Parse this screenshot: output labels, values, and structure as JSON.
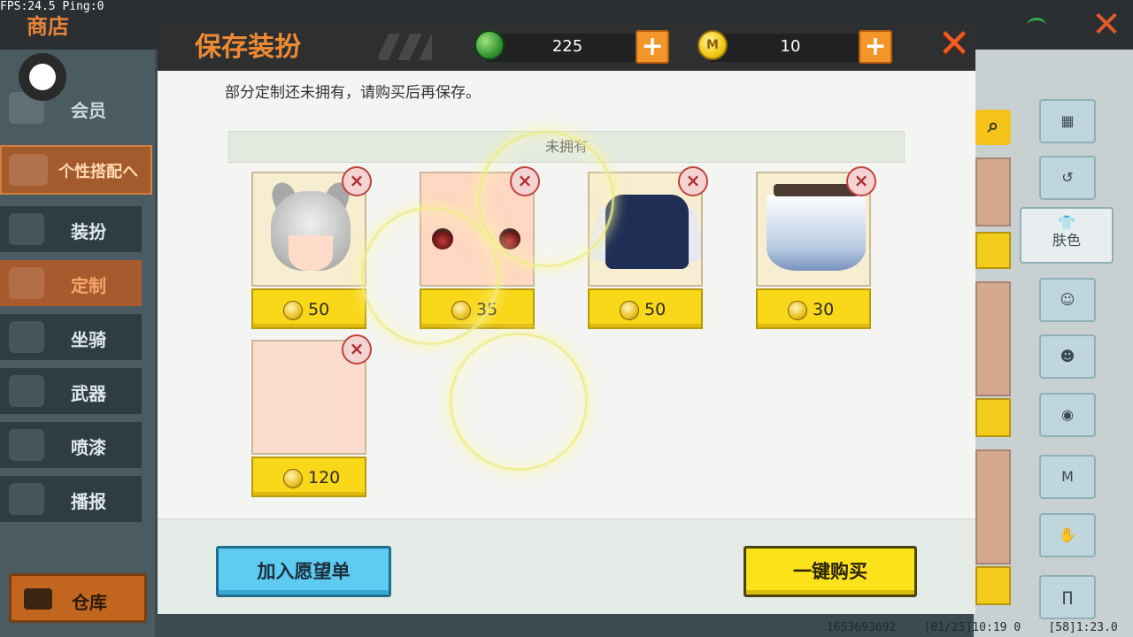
{
  "status": {
    "fps": "FPS:24.5",
    "ping": "Ping:0"
  },
  "shop": {
    "title": "商店"
  },
  "nav": {
    "vip": "会员",
    "group": "个性搭配へ",
    "items": [
      "装扮",
      "定制",
      "坐骑",
      "武器",
      "喷漆",
      "播报"
    ],
    "warehouse": "仓库"
  },
  "right_panel": {
    "skin_label": "肤色"
  },
  "modal": {
    "title": "保存装扮",
    "gems": "225",
    "coins": "10",
    "coin_symbol": "M",
    "notice": "部分定制还未拥有，请购买后再保存。",
    "section_header": "未拥有",
    "remove_symbol": "×",
    "items": [
      {
        "name": "cat-ear-hair",
        "price": "50"
      },
      {
        "name": "face",
        "price": "35"
      },
      {
        "name": "jacket",
        "price": "50"
      },
      {
        "name": "skirt",
        "price": "30"
      },
      {
        "name": "skin",
        "price": "120"
      }
    ],
    "wishlist_button": "加入愿望单",
    "buy_button": "一键购买"
  },
  "footer": {
    "info": "1653693692    [01/25]10:19 0    [58]1:23.0"
  },
  "colors": {
    "accent_orange": "#ef8a33",
    "gold": "#f9d719",
    "wish_blue": "#5fcbf2",
    "buy_yellow": "#fbe21b"
  }
}
